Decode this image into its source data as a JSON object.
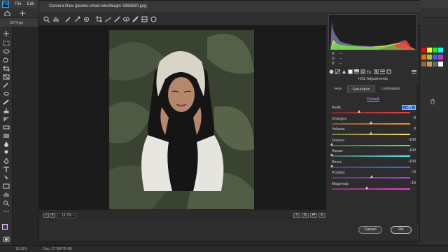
{
  "ps": {
    "logo": "Ps",
    "menu": [
      "File",
      "Edit"
    ],
    "doc_tab": "3074.jpg",
    "status_zoom": "16.05%",
    "status_doc": "Doc: 37.3M/76.4M"
  },
  "dialog": {
    "title": "Camera Raw (pexels-ichad-windhiagiri-3988680.jpg)",
    "zoom_level": "13.7%",
    "cancel_label": "Cancel",
    "ok_label": "OK"
  },
  "readout": {
    "r": "R:",
    "g": "G:",
    "b": "B:",
    "dash": "---"
  },
  "hsl": {
    "panel_title": "HSL Adjustments",
    "tabs": [
      "Hue",
      "Saturation",
      "Luminance"
    ],
    "active_tab": "Saturation",
    "default_label": "Default",
    "sliders": [
      {
        "label": "Reds",
        "value": "-30",
        "amount": -30,
        "editing": true,
        "colors": [
          "#7a2b2b",
          "#ff3b3b"
        ]
      },
      {
        "label": "Oranges",
        "value": "0",
        "amount": 0,
        "colors": [
          "#7a5a3a",
          "#ff8a2a"
        ]
      },
      {
        "label": "Yellows",
        "value": "0",
        "amount": 0,
        "colors": [
          "#7a7a4a",
          "#ffe83a"
        ]
      },
      {
        "label": "Greens",
        "value": "-100",
        "amount": -100,
        "colors": [
          "#4a6a4a",
          "#3cff3c"
        ]
      },
      {
        "label": "Aquas",
        "value": "-100",
        "amount": -100,
        "colors": [
          "#4a6a6a",
          "#3cffff"
        ]
      },
      {
        "label": "Blues",
        "value": "-100",
        "amount": -100,
        "colors": [
          "#3a4a7a",
          "#3a6aff"
        ]
      },
      {
        "label": "Purples",
        "value": "+3",
        "amount": 3,
        "colors": [
          "#5a3a7a",
          "#a83aff"
        ]
      },
      {
        "label": "Magentas",
        "value": "-10",
        "amount": -10,
        "colors": [
          "#7a3a6a",
          "#ff3ad0"
        ]
      }
    ]
  },
  "colors": {
    "accent": "#31a8ff",
    "dialog_bg": "#2d2d2d"
  }
}
